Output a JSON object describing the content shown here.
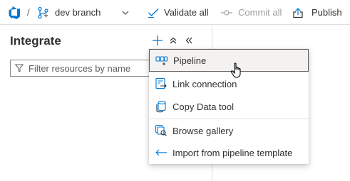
{
  "toolbar": {
    "separator": "/",
    "branch_label": "dev branch",
    "validate_all_label": "Validate all",
    "commit_all_label": "Commit all",
    "publish_label": "Publish"
  },
  "pane": {
    "title": "Integrate"
  },
  "filter": {
    "placeholder": "Filter resources by name"
  },
  "menu": {
    "items": [
      {
        "label": "Pipeline",
        "icon": "pipeline-icon"
      },
      {
        "label": "Link connection",
        "icon": "link-connection-icon"
      },
      {
        "label": "Copy Data tool",
        "icon": "copy-data-tool-icon"
      },
      {
        "label": "Browse gallery",
        "icon": "browse-gallery-icon"
      },
      {
        "label": "Import from pipeline template",
        "icon": "import-arrow-icon"
      }
    ]
  },
  "colors": {
    "accent": "#0078d4",
    "text": "#323130",
    "disabled_text": "#a19f9d",
    "border": "#e1dfdd",
    "hover_background": "#f3f2f1"
  }
}
